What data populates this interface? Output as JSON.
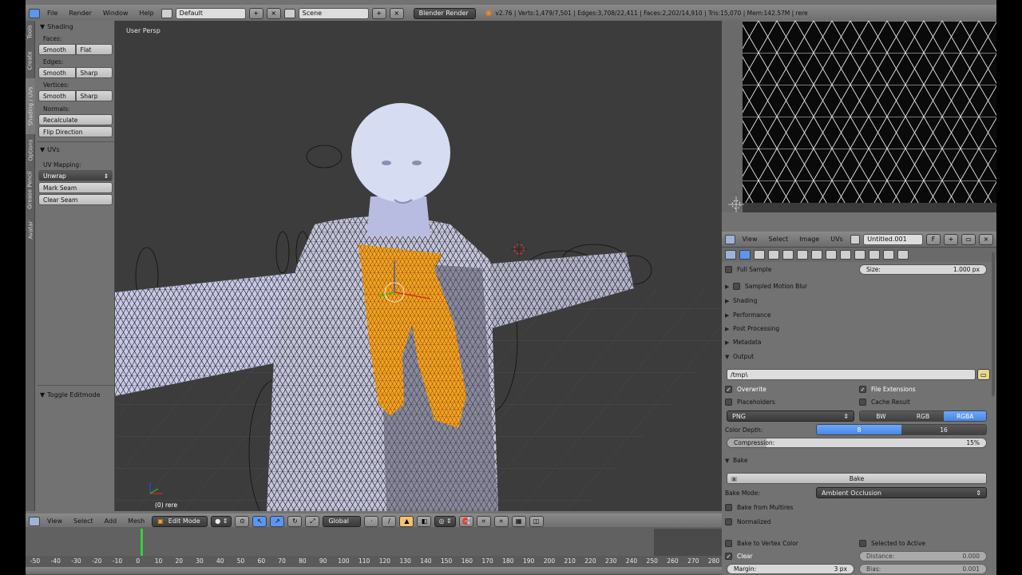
{
  "topbar": {
    "menus": [
      "File",
      "Render",
      "Window",
      "Help"
    ],
    "layout": "Default",
    "scene": "Scene",
    "engine": "Blender Render",
    "stats": "v2.76 | Verts:1,479/7,501 | Edges:3,708/22,411 | Faces:2,202/14,910 | Tris:15,070 | Mem:142.57M | rere"
  },
  "toolshelf": {
    "tabs": [
      "Tools",
      "Create",
      "Shading / UVs",
      "Options",
      "Grease Pencil",
      "Avatar"
    ],
    "shading": {
      "title": "Shading",
      "faces_label": "Faces:",
      "faces_buttons": [
        "Smooth",
        "Flat"
      ],
      "edges_label": "Edges:",
      "edges_buttons": [
        "Smooth",
        "Sharp"
      ],
      "vertices_label": "Vertices:",
      "vertices_buttons": [
        "Smooth",
        "Sharp"
      ],
      "normals_label": "Normals:",
      "recalculate": "Recalculate",
      "flip": "Flip Direction"
    },
    "uvs": {
      "title": "UVs",
      "mapping_label": "UV Mapping:",
      "unwrap": "Unwrap",
      "mark_seam": "Mark Seam",
      "clear_seam": "Clear Seam"
    },
    "toggle_editmode": "Toggle Editmode"
  },
  "viewport": {
    "label": "User Persp",
    "object": "(0) rere"
  },
  "viewport_header": {
    "menus": [
      "View",
      "Select",
      "Add",
      "Mesh"
    ],
    "mode": "Edit Mode",
    "orientation": "Global"
  },
  "timeline": {
    "ticks": [
      "-50",
      "-40",
      "-30",
      "-20",
      "-10",
      "0",
      "10",
      "20",
      "30",
      "40",
      "50",
      "60",
      "70",
      "80",
      "90",
      "100",
      "110",
      "120",
      "130",
      "140",
      "150",
      "160",
      "170",
      "180",
      "190",
      "200",
      "210",
      "220",
      "230",
      "240",
      "250",
      "260",
      "270",
      "280"
    ],
    "current_frame": 0
  },
  "image_editor_header": {
    "menus": [
      "View",
      "Select",
      "Image",
      "UVs"
    ],
    "image_name": "Untitled.001",
    "fake_user": "F"
  },
  "properties": {
    "full_sample": "Full Sample",
    "size_label": "Size:",
    "size_value": "1.000 px",
    "sampled_motion_blur": "Sampled Motion Blur",
    "panels": [
      "Shading",
      "Performance",
      "Post Processing",
      "Metadata"
    ],
    "output": {
      "title": "Output",
      "path": "/tmp\\",
      "overwrite": "Overwrite",
      "file_extensions": "File Extensions",
      "placeholders": "Placeholders",
      "cache_result": "Cache Result",
      "format": "PNG",
      "color_modes": [
        "BW",
        "RGB",
        "RGBA"
      ],
      "color_depth_label": "Color Depth:",
      "color_depths": [
        "8",
        "16"
      ],
      "compression_label": "Compression:",
      "compression_value": "15%",
      "compression_fraction": 0.15
    },
    "bake": {
      "title": "Bake",
      "bake_button": "Bake",
      "bake_mode_label": "Bake Mode:",
      "bake_mode": "Ambient Occlusion",
      "from_multires": "Bake from Multires",
      "normalized": "Normalized",
      "to_vertex_color": "Bake to Vertex Color",
      "selected_to_active": "Selected to Active",
      "clear": "Clear",
      "distance_label": "Distance:",
      "distance_value": "0.000",
      "margin_label": "Margin:",
      "margin_value": "3 px",
      "bias_label": "Bias:",
      "bias_value": "0.001"
    }
  },
  "colors": {
    "selection": "#f5a623",
    "accent_blue": "#5a96f0",
    "viewport_bg": "#3c3c3c"
  }
}
